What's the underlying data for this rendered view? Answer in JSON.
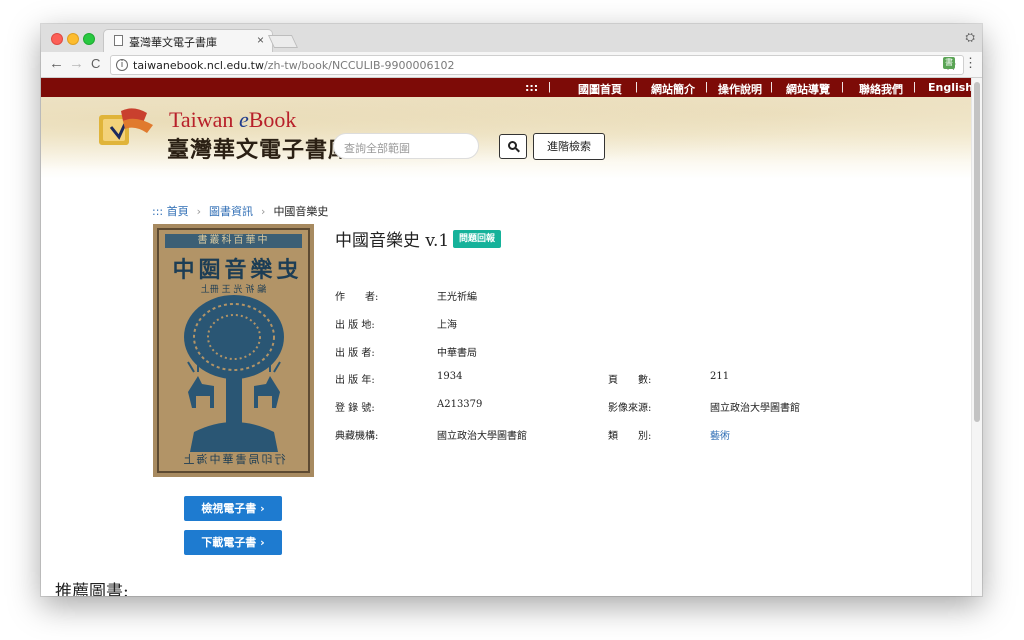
{
  "browser": {
    "tab_title": "臺灣華文電子書庫",
    "tab_close": "×",
    "url_host": "taiwanebook.ncl.edu.tw",
    "url_path": "/zh-tw/book/NCCULIB-9900006102",
    "back": "←",
    "forward": "→",
    "reload": "C",
    "star": "☆",
    "menu": "⋮",
    "ext_label": "書",
    "profile": "⛭"
  },
  "topnav": {
    "items": [
      "::: ",
      "國圖首頁",
      "網站簡介",
      "操作說明",
      "網站導覽",
      "聯絡我們",
      "English"
    ],
    "sep": "|"
  },
  "header": {
    "logo_en": "Taiwan ",
    "logo_en_e": "e",
    "logo_en_book": "Book",
    "logo_zh": "臺灣華文電子書庫",
    "search_placeholder": "查詢全部範圍",
    "advanced_search": "進階檢索"
  },
  "breadcrumb": {
    "home": "::: 首頁",
    "category": "圖書資訊",
    "current": "中國音樂史",
    "sep": "›"
  },
  "cover": {
    "band": "書叢科百華中",
    "title": "史樂音國中",
    "author": "編 祈 光 王   冊上",
    "publisher": "行印局書華中海上"
  },
  "book": {
    "title": "中國音樂史 v.1",
    "report_label": "問題回報",
    "fields": {
      "author_label": "作　　者:",
      "author": "王光祈編",
      "place_label": "出 版 地:",
      "place": "上海",
      "publisher_label": "出 版 者:",
      "publisher": "中華書局",
      "year_label": "出 版 年:",
      "year": "1934",
      "pages_label": "頁　　數:",
      "pages": "211",
      "accession_label": "登 錄 號:",
      "accession": "A213379",
      "source_label": "影像來源:",
      "source": "國立政治大學圖書館",
      "holding_label": "典藏機構:",
      "holding": "國立政治大學圖書館",
      "category_label": "類　　別:",
      "category": "藝術"
    }
  },
  "actions": {
    "view_ebook": "檢視電子書  ›",
    "download_ebook": "下載電子書  ›"
  },
  "recommend": {
    "title": "推薦圖書:"
  },
  "colors": {
    "topnav_bg": "#7d0b07",
    "button_blue": "#1e7bd0",
    "badge_teal": "#15b29a",
    "link_blue": "#2f6eb5"
  }
}
